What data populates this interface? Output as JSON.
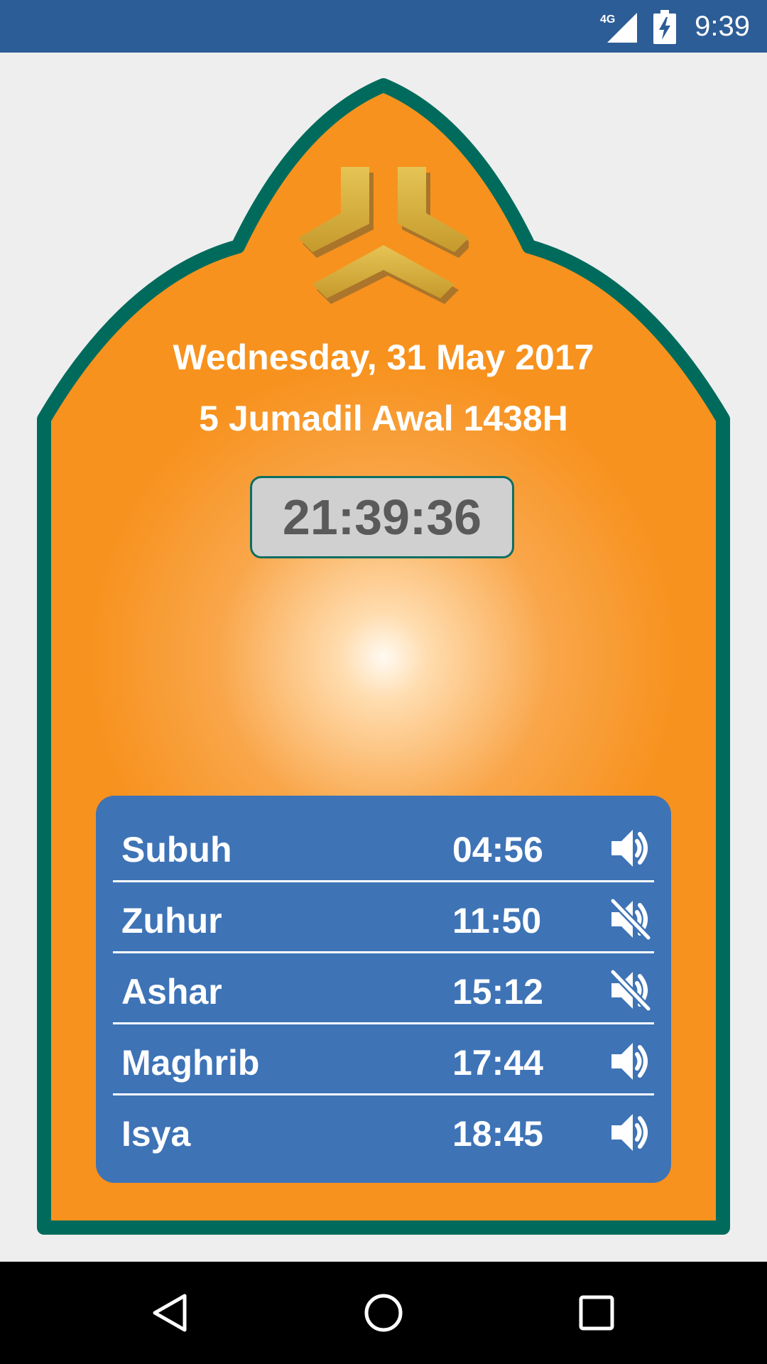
{
  "status_bar": {
    "network": "4G",
    "network_icon": "signal-4g-icon",
    "battery_icon": "battery-charging-icon",
    "time": "9:39"
  },
  "header": {
    "logo_icon": "logo-emblem",
    "gregorian_date": "Wednesday, 31 May 2017",
    "hijri_date": "5 Jumadil Awal 1438H",
    "current_time": "21:39:36"
  },
  "prayers": [
    {
      "name": "Subuh",
      "time": "04:56",
      "sound": "on",
      "icon": "volume-on-icon"
    },
    {
      "name": "Zuhur",
      "time": "11:50",
      "sound": "off",
      "icon": "volume-off-icon"
    },
    {
      "name": "Ashar",
      "time": "15:12",
      "sound": "off",
      "icon": "volume-off-icon"
    },
    {
      "name": "Maghrib",
      "time": "17:44",
      "sound": "on",
      "icon": "volume-on-icon"
    },
    {
      "name": "Isya",
      "time": "18:45",
      "sound": "on",
      "icon": "volume-on-icon"
    }
  ],
  "nav_bar": {
    "back_icon": "back-triangle-icon",
    "home_icon": "home-circle-icon",
    "recents_icon": "recents-square-icon"
  },
  "colors": {
    "status_bar": "#2c5d97",
    "frame_border": "#006b5c",
    "frame_fill": "#f7921e",
    "panel": "#3e73b6",
    "background": "#eeeeee"
  }
}
